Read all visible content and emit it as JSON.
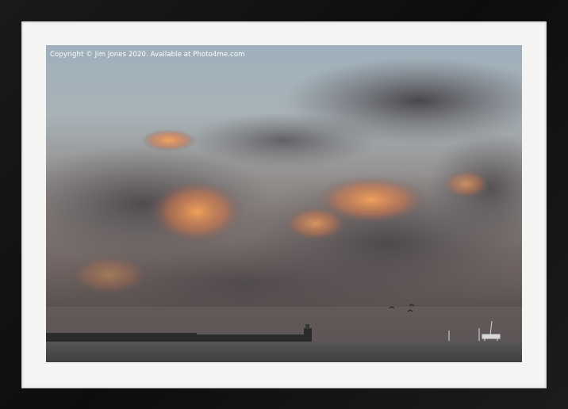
{
  "watermark": {
    "text": "Copyright  © Jim Jones  2020. Available at Photo4me.com"
  },
  "colors": {
    "frame": "#111111",
    "mount": "#f4f4f2",
    "sky": "#a8b2b7",
    "cloud_glow": "#f0904a",
    "sea": "#4d4b4c"
  }
}
